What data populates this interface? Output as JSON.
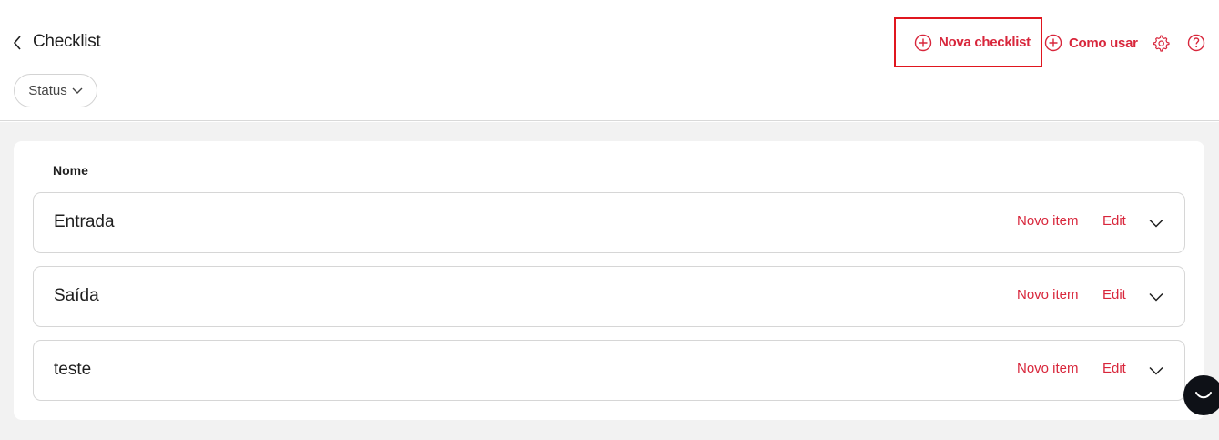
{
  "header": {
    "title": "Checklist",
    "status_filter": "Status",
    "new_checklist": "Nova checklist",
    "how_to_use": "Como usar"
  },
  "table": {
    "column_name": "Nome",
    "rows": [
      {
        "name": "Entrada",
        "new_item": "Novo item",
        "edit": "Edit"
      },
      {
        "name": "Saída",
        "new_item": "Novo item",
        "edit": "Edit"
      },
      {
        "name": "teste",
        "new_item": "Novo item",
        "edit": "Edit"
      }
    ]
  },
  "colors": {
    "accent": "#d8263b",
    "highlight_border": "#e0161f",
    "background": "#f2f2f2"
  },
  "icons": {
    "back": "chevron-left-icon",
    "status": "chevron-down-icon",
    "add": "plus-circle-icon",
    "settings": "gear-icon",
    "help": "question-circle-icon",
    "expand": "chevron-down-icon",
    "chat": "chat-icon"
  }
}
